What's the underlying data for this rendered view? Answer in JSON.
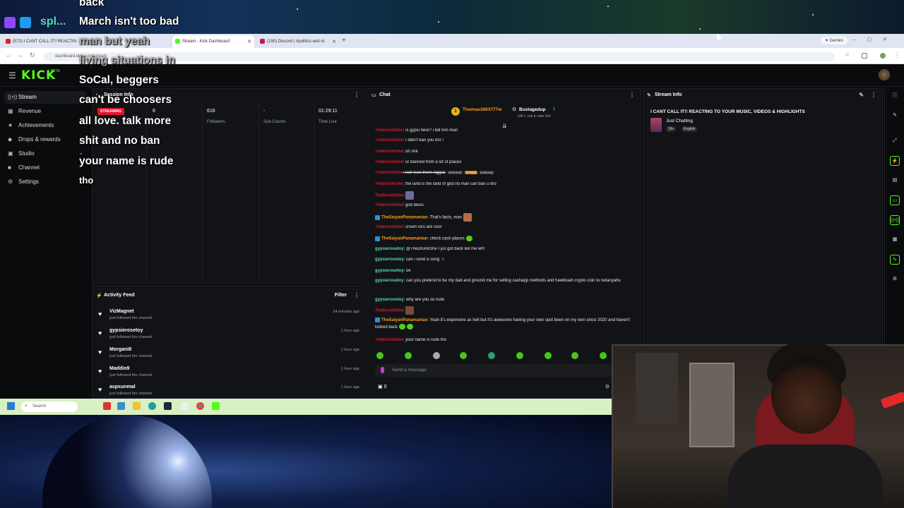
{
  "overlay": {
    "lines": [
      "back",
      "March isn't too bad",
      "man but yeah",
      "living situations in",
      "SoCal, beggers",
      "can't be choosers",
      "all love. talk more",
      "shit and no ban",
      "your name is rude",
      "tho"
    ],
    "stream_brand": "spl..."
  },
  "browser": {
    "tabs": [
      {
        "label": "(572) I CANT CALL IT!! REACTIN",
        "color": "#e02020"
      },
      {
        "label": "Stream - Kick Dashboard",
        "color": "#53fc18",
        "active": true
      },
      {
        "label": "(190) Discord | #politics-and-m",
        "color": "#c2185b"
      }
    ],
    "new_tab": "+",
    "gemini": "Gemini",
    "url": "dashboard.kick.com/stream"
  },
  "kick": {
    "logo": "KICK",
    "logo_tm": "BETA"
  },
  "sidebar": {
    "items": [
      {
        "label": "Stream",
        "icon": "stream-icon",
        "glyph": "((•))"
      },
      {
        "label": "Revenue",
        "icon": "revenue-icon",
        "glyph": "▦"
      },
      {
        "label": "Achievements",
        "icon": "trophy-icon",
        "glyph": "★"
      },
      {
        "label": "Drops & rewards",
        "icon": "gift-icon",
        "glyph": "◆"
      },
      {
        "label": "Studio",
        "icon": "studio-icon",
        "glyph": "▣"
      },
      {
        "label": "Channel",
        "icon": "channel-icon",
        "glyph": "■"
      },
      {
        "label": "Settings",
        "icon": "gear-icon",
        "glyph": "⚙"
      }
    ]
  },
  "session": {
    "title": "Session Info",
    "badge": "STREAMING",
    "viewers": "6",
    "followers_value": "616",
    "followers_label": "Followers",
    "sub_value": "-",
    "sub_label": "Sub Counts",
    "time_value": "01:29:11",
    "time_label": "Time Live"
  },
  "activity": {
    "title": "Activity Feed",
    "filter": "Filter",
    "rows": [
      {
        "name": "VizMagnet",
        "action": "just followed the channel",
        "time": "24 minutes ago"
      },
      {
        "name": "gypsierosetoy",
        "action": "just followed the channel",
        "time": "1 hour ago"
      },
      {
        "name": "Morgani8",
        "action": "just followed the channel",
        "time": "1 hour ago"
      },
      {
        "name": "Maddio9",
        "action": "just followed the channel",
        "time": "1 hour ago"
      },
      {
        "name": "aspsunmal",
        "action": "just followed the channel",
        "time": "1 hour ago"
      }
    ]
  },
  "chat": {
    "title": "Chat",
    "pinned_user": "Thomas3663777w",
    "pinned_badge": "1",
    "pinned_gifter": "Bustagedup",
    "pinned_gift_count": "1",
    "pinned_sub": "Gift 1 sub to take 3rd",
    "messages": [
      {
        "user": "TheDrunkOne",
        "cls": "u-red",
        "text": ": is gypsi here? i tell him man"
      },
      {
        "user": "TheDrunkOne",
        "cls": "u-red",
        "text": ": I didn't ban you bro !"
      },
      {
        "user": "TheDrunkOne",
        "cls": "u-red",
        "text": ": oh shit"
      },
      {
        "user": "TheDrunkOne",
        "cls": "u-red",
        "text": ": ur banned from a lot of places"
      },
      {
        "user": "TheDrunkOne",
        "cls": "u-red",
        "text": ": nah fuck them niggas",
        "tags": [
          "(Deleted)",
          "AI Mod",
          "(bullying)"
        ]
      },
      {
        "user": "TheDrunkOne",
        "cls": "u-red",
        "text": ": the land is the land of god no man can ban u bro"
      },
      {
        "user": "TheDrunkOne",
        "cls": "u-red",
        "text": ":"
      },
      {
        "user": "TheDrunkOne",
        "cls": "u-red",
        "text": ": god bless"
      },
      {
        "user": "TheSaiyanPanamanian",
        "cls": "u-orange",
        "text": ": That's facts, man"
      },
      {
        "user": "TheDrunkOne",
        "cls": "u-red",
        "text": ": crown vics are cool"
      },
      {
        "user": "TheSaiyanPanamanian",
        "cls": "u-orange",
        "text": ": check cash places"
      },
      {
        "user": "gypsierosetoy",
        "cls": "u-teal",
        "text": ": @TheDrunkOne I jus got back tell me wht"
      },
      {
        "user": "gypsierosetoy",
        "cls": "u-teal",
        "text": ": can i send a song"
      },
      {
        "user": "gypsierosetoy",
        "cls": "u-teal",
        "text": ": ok"
      },
      {
        "user": "gypsierosetoy",
        "cls": "u-teal",
        "text": ": can you pretend to be my dad and ground me for selling cashapp methods and hawktuah crypto coin to netanyahu"
      },
      {
        "user": "gypsierosetoy",
        "cls": "u-teal",
        "text": ": why are you so rude"
      },
      {
        "user": "TheDrunkOne",
        "cls": "u-red",
        "text": ":"
      },
      {
        "user": "TheSaiyanPanamanian",
        "cls": "u-orange",
        "text": ": Yeah it's expensive as hell but it's awesome having your own spot been on my own since 2020 and haven't looked back"
      },
      {
        "user": "TheDrunkOne",
        "cls": "u-red",
        "text": ": your name is rude tho"
      }
    ],
    "input_placeholder": "Send a message",
    "bottom_count": "0"
  },
  "stream_info": {
    "title": "Stream Info",
    "stream_title": "I CANT CALL IT!! REACTING TO YOUR MUSIC, VIDEOS & HIGHLIGHTS",
    "category": "Just Chatting",
    "tags": [
      "18+",
      "English"
    ]
  },
  "taskbar": {
    "search": "Search"
  },
  "colors": {
    "kick_green": "#53fc18",
    "streaming_red": "#e0162b",
    "panel_bg": "#121316"
  }
}
